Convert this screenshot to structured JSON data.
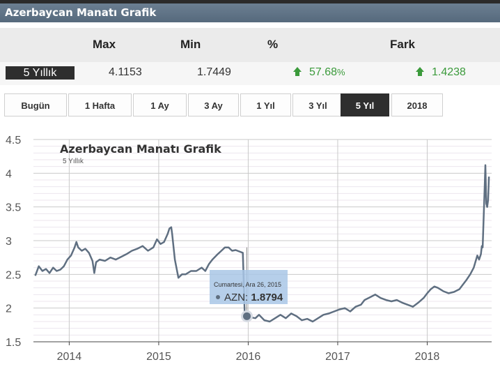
{
  "header": {
    "title": "Azerbaycan Manatı Grafik"
  },
  "stats": {
    "headers": [
      "Max",
      "Min",
      "%",
      "Fark"
    ],
    "period": "5 Yıllık",
    "max": "4.1153",
    "min": "1.7449",
    "percent": "57.68",
    "percent_unit": "%",
    "fark": "1.4238",
    "up_color": "#3b9a3b"
  },
  "tabs": [
    {
      "label": "Bugün",
      "active": false
    },
    {
      "label": "1 Hafta",
      "active": false
    },
    {
      "label": "1 Ay",
      "active": false
    },
    {
      "label": "3 Ay",
      "active": false
    },
    {
      "label": "1 Yıl",
      "active": false
    },
    {
      "label": "3 Yıl",
      "active": false
    },
    {
      "label": "5 Yıl",
      "active": true
    },
    {
      "label": "2018",
      "active": false
    }
  ],
  "tooltip": {
    "date": "Cumartesi, Ara 26, 2015",
    "series": "AZN",
    "value": "1.8794"
  },
  "chart_data": {
    "type": "line",
    "title": "Azerbaycan Manatı Grafik",
    "subtitle": "5 Yıllık",
    "xlabel": "",
    "ylabel": "",
    "ylim": [
      1.5,
      4.5
    ],
    "xlim": [
      2013.6,
      2018.72
    ],
    "yticks": [
      "4.5",
      "4",
      "3.5",
      "3",
      "2.5",
      "2",
      "1.5"
    ],
    "xticks": [
      "2014",
      "2015",
      "2016",
      "2017",
      "2018"
    ],
    "grid": true,
    "line_color": "#5f6f81",
    "series": [
      {
        "name": "AZN",
        "x": [
          2013.62,
          2013.66,
          2013.7,
          2013.74,
          2013.78,
          2013.82,
          2013.86,
          2013.9,
          2013.94,
          2013.98,
          2014.02,
          2014.06,
          2014.08,
          2014.1,
          2014.14,
          2014.18,
          2014.22,
          2014.26,
          2014.28,
          2014.3,
          2014.34,
          2014.4,
          2014.46,
          2014.52,
          2014.58,
          2014.64,
          2014.7,
          2014.76,
          2014.82,
          2014.88,
          2014.94,
          2014.98,
          2015.02,
          2015.06,
          2015.1,
          2015.12,
          2015.14,
          2015.15,
          2015.18,
          2015.22,
          2015.26,
          2015.3,
          2015.36,
          2015.42,
          2015.48,
          2015.52,
          2015.56,
          2015.6,
          2015.66,
          2015.7,
          2015.74,
          2015.78,
          2015.82,
          2015.86,
          2015.9,
          2015.94,
          2015.96,
          2015.98,
          2016.0,
          2016.04,
          2016.08,
          2016.12,
          2016.18,
          2016.24,
          2016.3,
          2016.36,
          2016.42,
          2016.48,
          2016.54,
          2016.6,
          2016.66,
          2016.72,
          2016.78,
          2016.84,
          2016.9,
          2016.96,
          2017.02,
          2017.08,
          2017.14,
          2017.2,
          2017.26,
          2017.3,
          2017.36,
          2017.42,
          2017.48,
          2017.54,
          2017.6,
          2017.66,
          2017.72,
          2017.78,
          2017.84,
          2017.9,
          2017.96,
          2018.0,
          2018.04,
          2018.08,
          2018.12,
          2018.18,
          2018.24,
          2018.3,
          2018.36,
          2018.4,
          2018.44,
          2018.48,
          2018.52,
          2018.56,
          2018.58,
          2018.6,
          2018.61,
          2018.62,
          2018.63,
          2018.64,
          2018.65,
          2018.66,
          2018.67,
          2018.68,
          2018.69
        ],
        "y": [
          2.48,
          2.62,
          2.55,
          2.58,
          2.52,
          2.6,
          2.55,
          2.57,
          2.62,
          2.72,
          2.78,
          2.9,
          2.98,
          2.9,
          2.85,
          2.88,
          2.82,
          2.7,
          2.52,
          2.68,
          2.72,
          2.7,
          2.75,
          2.72,
          2.76,
          2.8,
          2.85,
          2.88,
          2.92,
          2.85,
          2.9,
          3.02,
          2.95,
          2.98,
          3.1,
          3.18,
          3.2,
          3.1,
          2.72,
          2.45,
          2.5,
          2.5,
          2.55,
          2.55,
          2.6,
          2.55,
          2.65,
          2.72,
          2.8,
          2.85,
          2.9,
          2.9,
          2.85,
          2.86,
          2.84,
          2.82,
          1.95,
          1.9,
          1.88,
          1.86,
          1.85,
          1.9,
          1.82,
          1.8,
          1.85,
          1.9,
          1.85,
          1.92,
          1.88,
          1.82,
          1.84,
          1.8,
          1.85,
          1.9,
          1.92,
          1.95,
          1.98,
          2.0,
          1.95,
          2.02,
          2.05,
          2.12,
          2.16,
          2.2,
          2.15,
          2.12,
          2.1,
          2.12,
          2.08,
          2.05,
          2.02,
          2.08,
          2.15,
          2.22,
          2.28,
          2.32,
          2.3,
          2.25,
          2.22,
          2.24,
          2.28,
          2.35,
          2.42,
          2.5,
          2.6,
          2.78,
          2.72,
          2.8,
          2.92,
          2.9,
          3.3,
          3.7,
          4.12,
          3.55,
          3.5,
          3.6,
          3.95
        ]
      }
    ]
  }
}
